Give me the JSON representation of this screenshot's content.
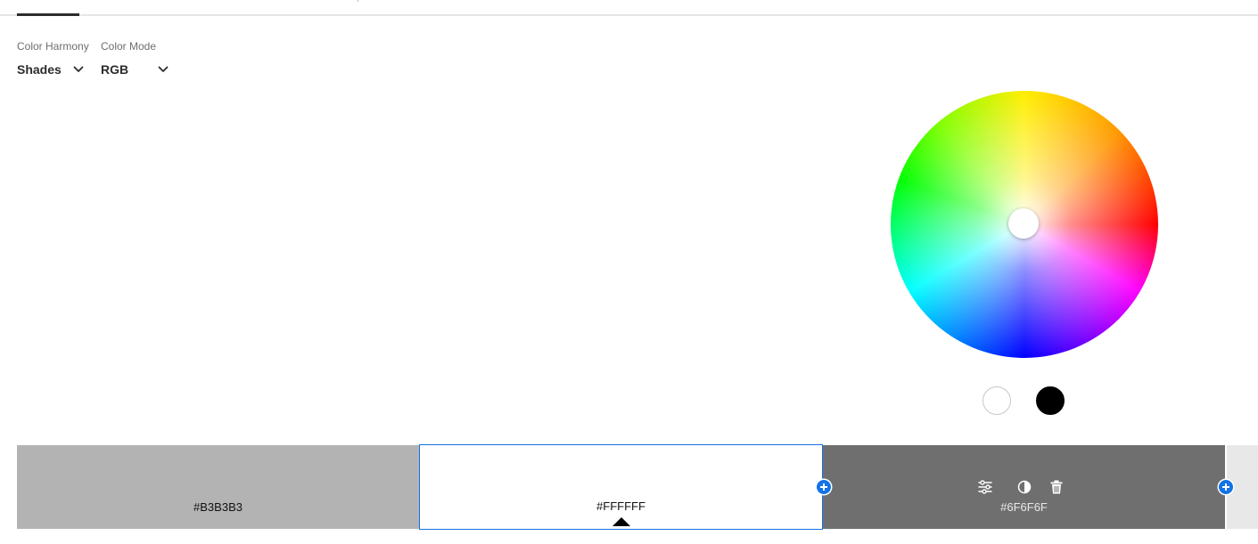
{
  "controls": {
    "harmony": {
      "label": "Color Harmony",
      "value": "Shades"
    },
    "mode": {
      "label": "Color Mode",
      "value": "RGB"
    }
  },
  "color_wheel": {
    "handle_color": "#FFFFFF",
    "preset_swatches": [
      "#FFFFFF",
      "#000000"
    ]
  },
  "swatches": [
    {
      "hex": "#B3B3B3",
      "color": "#b3b3b3",
      "selected": false
    },
    {
      "hex": "#FFFFFF",
      "color": "#ffffff",
      "selected": true
    },
    {
      "hex": "#6F6F6F",
      "color": "#6f6f6f",
      "selected": false
    },
    {
      "hex": "",
      "color": "#e8e8e8",
      "selected": false
    }
  ],
  "swatch_action_icons": [
    "adjust-icon",
    "contrast-icon",
    "trash-icon"
  ],
  "accent_color": "#1473E6"
}
